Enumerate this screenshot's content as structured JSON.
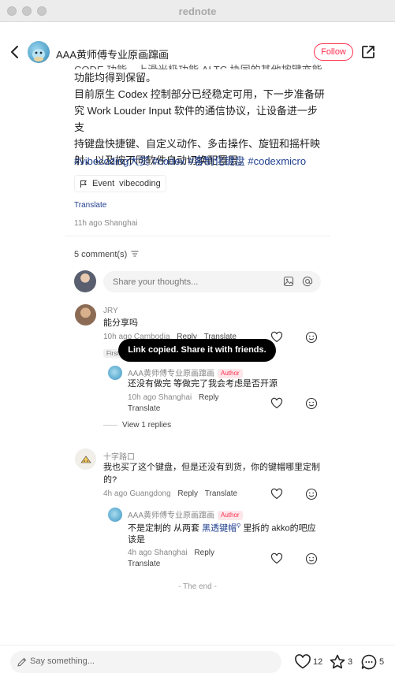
{
  "window": {
    "title": "rednote"
  },
  "header": {
    "author_name": "AAA黄师傅专业原画蹿画",
    "follow_label": "Follow"
  },
  "post": {
    "clipped_line": "CODE 功能，上滑光极功能 ALTC 协同的其他按键亦能",
    "line1": "功能均得到保留。",
    "line2": "目前原生 Codex 控制部分已经稳定可用，下一步准备研",
    "line3": "究 Work Louder Input 软件的通信协议，让设备进一步支",
    "line4": "持键盘快捷键、自定义动作、多击操作、旋钮和摇杆映",
    "line5": "射，以及按不同软件自动切换配置层。",
    "hashtags": "#vibecoding大赏 #codex #客制化键盘 #codexmicro",
    "event_label": "Event",
    "event_value": "vibecoding",
    "translate": "Translate",
    "meta": "11h ago Shanghai"
  },
  "comments_header": {
    "count_label": "5 comment(s)"
  },
  "comment_input": {
    "placeholder": "Share your thoughts..."
  },
  "comments": [
    {
      "name": "JRY",
      "text": "能分享吗",
      "meta": "10h ago Cambodia",
      "reply": "Reply",
      "translate": "Translate",
      "chip": "First",
      "replies": [
        {
          "name": "AAA黄师傅专业原画蹿画",
          "badge": "Author",
          "text": "还没有做完 等做完了我会考虑是否开源",
          "meta": "10h ago Shanghai",
          "reply": "Reply",
          "translate": "Translate"
        }
      ],
      "view_replies": "View 1 replies"
    },
    {
      "name": "十字路口",
      "text_line1": "我也买了这个键盘，但是还没有到货，你的键帽哪里定制",
      "text_line2": "的?",
      "meta": "4h ago Guangdong",
      "reply": "Reply",
      "translate": "Translate",
      "replies": [
        {
          "name": "AAA黄师傅专业原画蹿画",
          "badge": "Author",
          "text_pre": "不是定制的 从两套 ",
          "text_link": "黑透键帽",
          "text_post": " 里拆的 akko的吧应",
          "text_line2": "该是",
          "meta": "4h ago Shanghai",
          "reply": "Reply",
          "translate": "Translate"
        }
      ]
    }
  ],
  "end_label": "- The end -",
  "toast": "Link copied. Share it with friends.",
  "bottom_bar": {
    "placeholder": "Say something...",
    "likes": "12",
    "stars": "3",
    "comments": "5"
  },
  "colors": {
    "accent": "#ff2e4d",
    "link": "#1f3f8f"
  }
}
